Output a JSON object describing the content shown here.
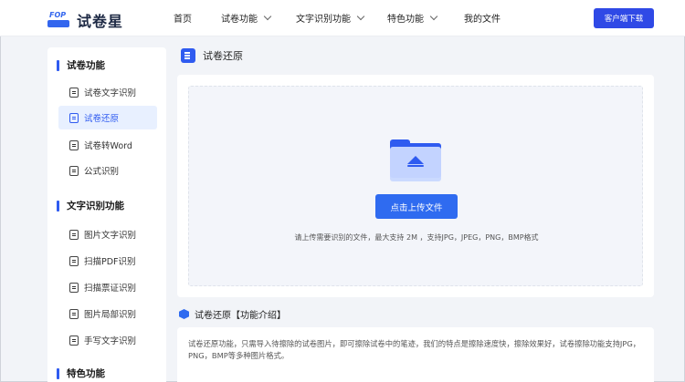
{
  "header": {
    "logo_text": "试卷星",
    "logo_small": "FOP",
    "nav": [
      {
        "label": "首页",
        "has_dropdown": false
      },
      {
        "label": "试卷功能",
        "has_dropdown": true
      },
      {
        "label": "文字识别功能",
        "has_dropdown": true
      },
      {
        "label": "特色功能",
        "has_dropdown": true
      },
      {
        "label": "我的文件",
        "has_dropdown": false
      }
    ],
    "download_label": "客户端下载"
  },
  "sidebar": {
    "groups": [
      {
        "title": "试卷功能",
        "items": [
          {
            "label": "试卷文字识别",
            "icon": "scan-doc-icon",
            "active": false
          },
          {
            "label": "试卷还原",
            "icon": "doc-restore-icon",
            "active": true
          },
          {
            "label": "试卷转Word",
            "icon": "word-icon",
            "active": false
          },
          {
            "label": "公式识别",
            "icon": "formula-icon",
            "active": false
          }
        ]
      },
      {
        "title": "文字识别功能",
        "items": [
          {
            "label": "图片文字识别",
            "icon": "image-text-icon",
            "active": false
          },
          {
            "label": "扫描PDF识别",
            "icon": "pdf-icon",
            "active": false
          },
          {
            "label": "扫描票证识别",
            "icon": "ticket-icon",
            "active": false
          },
          {
            "label": "图片局部识别",
            "icon": "crop-icon",
            "active": false
          },
          {
            "label": "手写文字识别",
            "icon": "handwriting-icon",
            "active": false
          }
        ]
      },
      {
        "title": "特色功能",
        "items": []
      }
    ]
  },
  "main": {
    "title": "试卷还原",
    "upload": {
      "button_label": "点击上传文件",
      "hint": "请上传需要识别的文件，最大支持 2M ，支持JPG，JPEG，PNG，BMP格式"
    },
    "intro": {
      "title": "试卷还原【功能介绍】",
      "text": "试卷还原功能，只需导入待擦除的试卷图片，即可擦除试卷中的笔迹，我们的特点是擦除速度快，擦除效果好，试卷擦除功能支持JPG，PNG，BMP等多种图片格式。"
    }
  },
  "colors": {
    "accent": "#2f5bf0",
    "active_bg": "#e8f0ff",
    "page_bg": "#f2f4f8"
  }
}
